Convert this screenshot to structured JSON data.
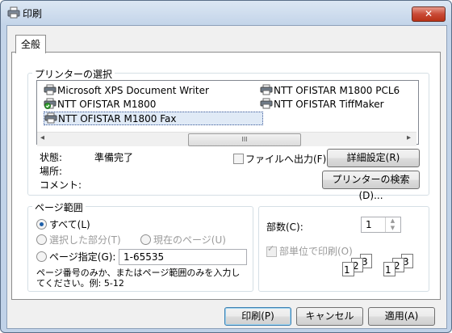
{
  "window": {
    "title": "印刷",
    "close_glyph": "✕"
  },
  "tab": {
    "label": "全般"
  },
  "printer_select": {
    "legend": "プリンターの選択",
    "printers": [
      {
        "name": "Microsoft XPS Document Writer"
      },
      {
        "name": "NTT OFISTAR M1800 PCL6"
      },
      {
        "name": "NTT OFISTAR M1800"
      },
      {
        "name": "NTT OFISTAR TiffMaker"
      },
      {
        "name": "NTT OFISTAR M1800 Fax"
      }
    ],
    "scroll_left": "◂",
    "scroll_right": "▸",
    "thumb_grip": "III",
    "status_label": "状態:",
    "status_value": "準備完了",
    "location_label": "場所:",
    "comment_label": "コメント:",
    "print_to_file": "ファイルへ出力(F)",
    "details_button": "詳細設定(R)",
    "find_printer_button": "プリンターの検索(D)..."
  },
  "page_range": {
    "legend": "ページ範囲",
    "all": "すべて(L)",
    "selection": "選択した部分(T)",
    "current_page": "現在のページ(U)",
    "pages": "ページ指定(G):",
    "pages_value": "1-65535",
    "hint_line1": "ページ番号のみか、またはページ範囲のみを入力し",
    "hint_line2": "てください。例: 5-12"
  },
  "copies": {
    "label": "部数(C):",
    "value": "1",
    "collate": "部単位で印刷(O)",
    "spin_up": "▲",
    "spin_down": "▼",
    "page_labels": [
      "1",
      "2",
      "3",
      "1",
      "2",
      "3"
    ]
  },
  "footer": {
    "print_button": "印刷(P)",
    "cancel_button": "キャンセル",
    "apply_button": "適用(A)"
  }
}
